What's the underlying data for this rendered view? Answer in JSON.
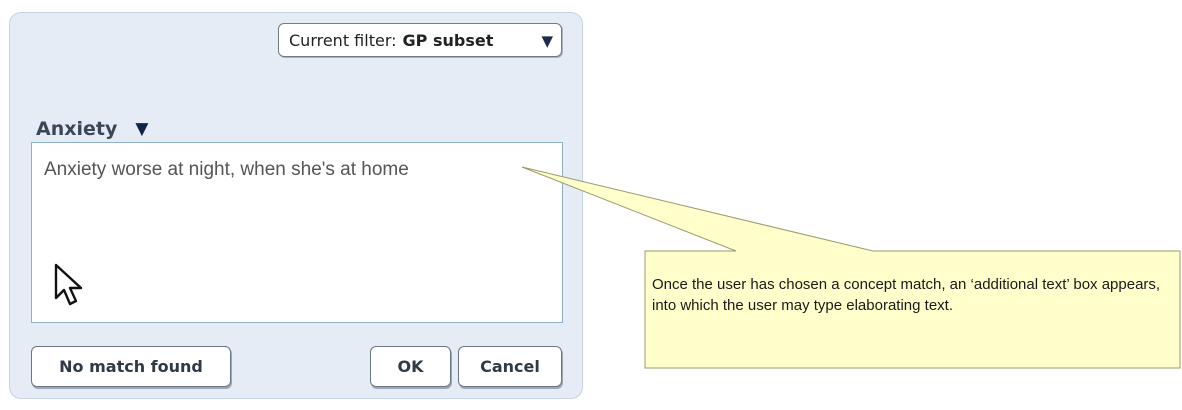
{
  "dialog": {
    "filter": {
      "prefix": "Current filter:",
      "value": "GP subset"
    },
    "concept": {
      "label": "Anxiety"
    },
    "additional_text": {
      "value": "Anxiety worse at night, when she's at home"
    },
    "buttons": {
      "no_match": "No match found",
      "ok": "OK",
      "cancel": "Cancel"
    }
  },
  "callout": {
    "text": "Once the user has chosen a concept match, an ‘additional text’ box appears, into which the user may type elaborating text.",
    "fill_color": "#ffffcc",
    "border_color": "#9b9b6a"
  },
  "icons": {
    "dropdown": "chevron-down-icon",
    "cursor": "mouse-pointer-icon"
  }
}
